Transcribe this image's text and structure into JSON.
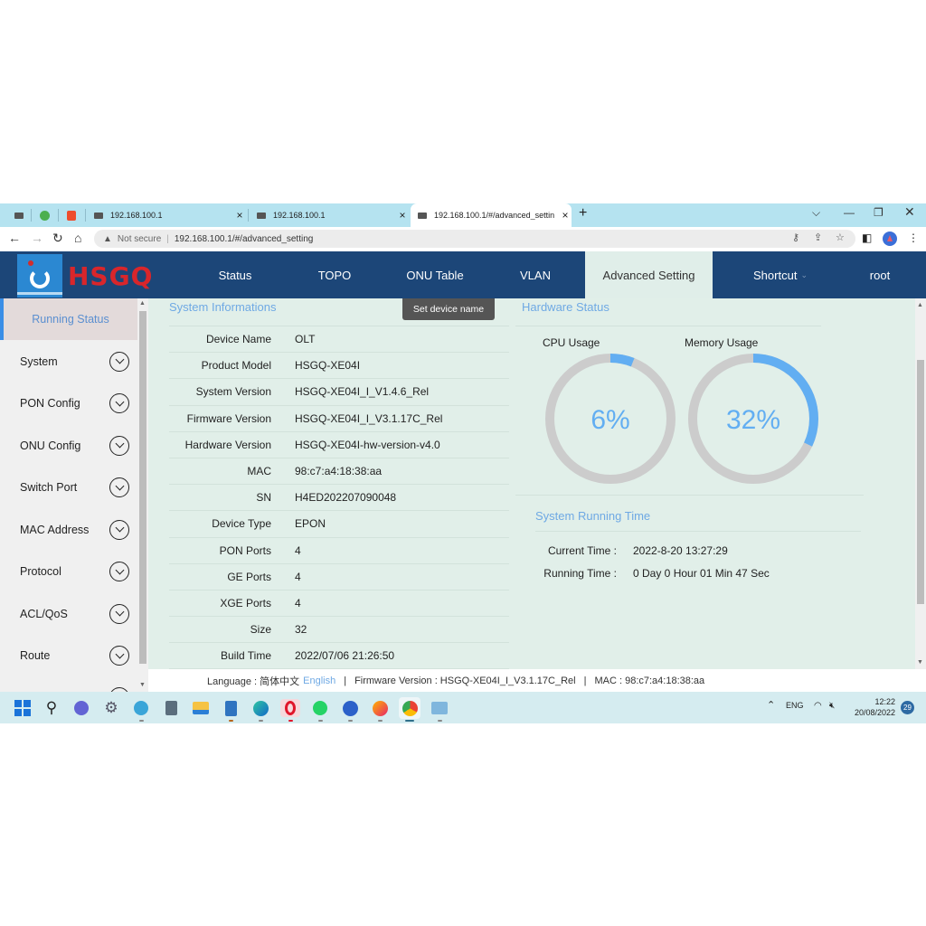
{
  "browser": {
    "pinned_tabs": [
      {
        "icon": "pin-page-icon"
      },
      {
        "icon": "frog-app-icon"
      },
      {
        "icon": "shopee-icon"
      }
    ],
    "tabs": [
      {
        "title": "192.168.100.1",
        "active": false
      },
      {
        "title": "192.168.100.1",
        "active": false
      },
      {
        "title": "192.168.100.1/#/advanced_settin",
        "active": true
      }
    ],
    "new_tab": "+",
    "address": {
      "security_label": "Not secure",
      "url": "192.168.100.1/#/advanced_setting"
    }
  },
  "app": {
    "logo_text": "HSGQ",
    "nav": [
      {
        "label": "Status",
        "active": false
      },
      {
        "label": "TOPO",
        "active": false
      },
      {
        "label": "ONU Table",
        "active": false
      },
      {
        "label": "VLAN",
        "active": false
      },
      {
        "label": "Advanced Setting",
        "active": true
      },
      {
        "label": "Shortcut",
        "active": false,
        "has_dropdown": true
      },
      {
        "label": "root",
        "active": false
      }
    ],
    "sidebar": {
      "items": [
        {
          "label": "Running Status",
          "active": true
        },
        {
          "label": "System"
        },
        {
          "label": "PON Config"
        },
        {
          "label": "ONU Config"
        },
        {
          "label": "Switch Port"
        },
        {
          "label": "MAC Address"
        },
        {
          "label": "Protocol"
        },
        {
          "label": "ACL/QoS"
        },
        {
          "label": "Route"
        }
      ]
    },
    "system_info": {
      "title": "System Informations",
      "set_device_name_button": "Set device name",
      "rows": [
        {
          "key": "Device Name",
          "value": "OLT"
        },
        {
          "key": "Product Model",
          "value": "HSGQ-XE04I"
        },
        {
          "key": "System Version",
          "value": "HSGQ-XE04I_I_V1.4.6_Rel"
        },
        {
          "key": "Firmware Version",
          "value": "HSGQ-XE04I_I_V3.1.17C_Rel"
        },
        {
          "key": "Hardware Version",
          "value": "HSGQ-XE04I-hw-version-v4.0"
        },
        {
          "key": "MAC",
          "value": "98:c7:a4:18:38:aa"
        },
        {
          "key": "SN",
          "value": "H4ED202207090048"
        },
        {
          "key": "Device Type",
          "value": "EPON"
        },
        {
          "key": "PON Ports",
          "value": "4"
        },
        {
          "key": "GE Ports",
          "value": "4"
        },
        {
          "key": "XGE Ports",
          "value": "4"
        },
        {
          "key": "Size",
          "value": "32"
        },
        {
          "key": "Build Time",
          "value": "2022/07/06 21:26:50"
        }
      ]
    },
    "hardware_status": {
      "title": "Hardware Status",
      "cpu": {
        "label": "CPU Usage",
        "percent": 6,
        "display": "6%"
      },
      "memory": {
        "label": "Memory Usage",
        "percent": 32,
        "display": "32%"
      },
      "colors": {
        "fill": "#62aef2",
        "track": "#cccccc",
        "text": "#62aef2"
      }
    },
    "running_time": {
      "title": "System Running Time",
      "current_time_label": "Current Time :",
      "current_time": "2022-8-20 13:27:29",
      "running_time_label": "Running Time :",
      "running_time": "0 Day 0 Hour 01 Min 47 Sec"
    },
    "footer": {
      "language_label": "Language : 简体中文",
      "english_link": "English",
      "sep": "|",
      "firmware": "Firmware Version : HSGQ-XE04I_I_V3.1.17C_Rel",
      "mac": "MAC : 98:c7:a4:18:38:aa"
    }
  },
  "taskbar": {
    "apps": [
      "start-icon",
      "search-icon",
      "teams-chat-icon",
      "settings-icon",
      "paint-icon",
      "calculator-icon",
      "file-explorer-icon",
      "notepad-icon",
      "edge-icon",
      "opera-icon",
      "whatsapp-icon",
      "app-globe-icon",
      "firefox-icon",
      "chrome-icon",
      "control-panel-icon"
    ],
    "tray": {
      "language": "ENG",
      "time": "12:22",
      "date": "20/08/2022",
      "notifications": "29"
    }
  },
  "colors": {
    "header_bg": "#1c4678",
    "content_bg": "#e1efe9",
    "accent_blue": "#6fa9e4",
    "logo_red": "#d9262b"
  }
}
